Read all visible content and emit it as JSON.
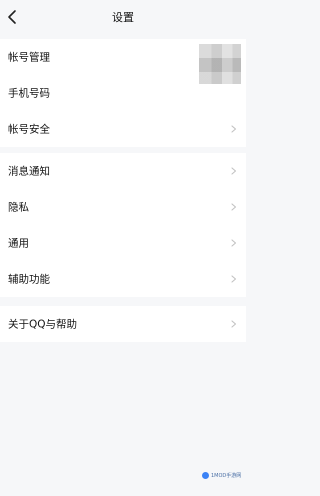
{
  "header": {
    "title": "设置"
  },
  "groups": {
    "account": {
      "manage": "帐号管理",
      "phone": "手机号码",
      "security": "帐号安全"
    },
    "general": {
      "notifications": "消息通知",
      "privacy": "隐私",
      "general": "通用",
      "accessibility": "辅助功能"
    },
    "about": {
      "about_label": "关于QQ与帮助"
    }
  },
  "watermark": {
    "text": "1MOD手游网"
  },
  "icons": {
    "back": "chevron-left-icon",
    "row_arrow": "chevron-right-icon"
  },
  "colors": {
    "background": "#f6f7f9",
    "row_background": "#ffffff",
    "chevron": "#c2c2c2"
  }
}
